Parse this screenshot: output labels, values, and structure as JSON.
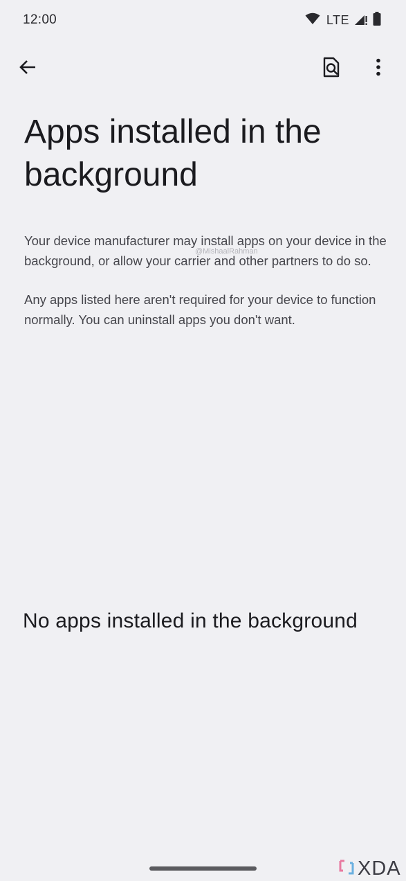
{
  "status_bar": {
    "time": "12:00",
    "network": "LTE"
  },
  "app_bar": {
    "back_icon": "arrow-back-icon",
    "search_icon": "document-search-icon",
    "more_icon": "more-vert-icon"
  },
  "page": {
    "title": "Apps installed in the background",
    "description_1": "Your device manufacturer may install apps on your device in the background, or allow your carrier and other partners to do so.",
    "description_2": "Any apps listed here aren't required for your device to function normally. You can uninstall apps you don't want.",
    "empty_state": "No apps installed in the background"
  },
  "watermark": "@MishaalRahman",
  "brand": {
    "text": "XDA",
    "accent_color": "#e87aa0"
  },
  "colors": {
    "background": "#f0f0f3",
    "text_primary": "#1b1b1f",
    "text_secondary": "#46464c"
  }
}
